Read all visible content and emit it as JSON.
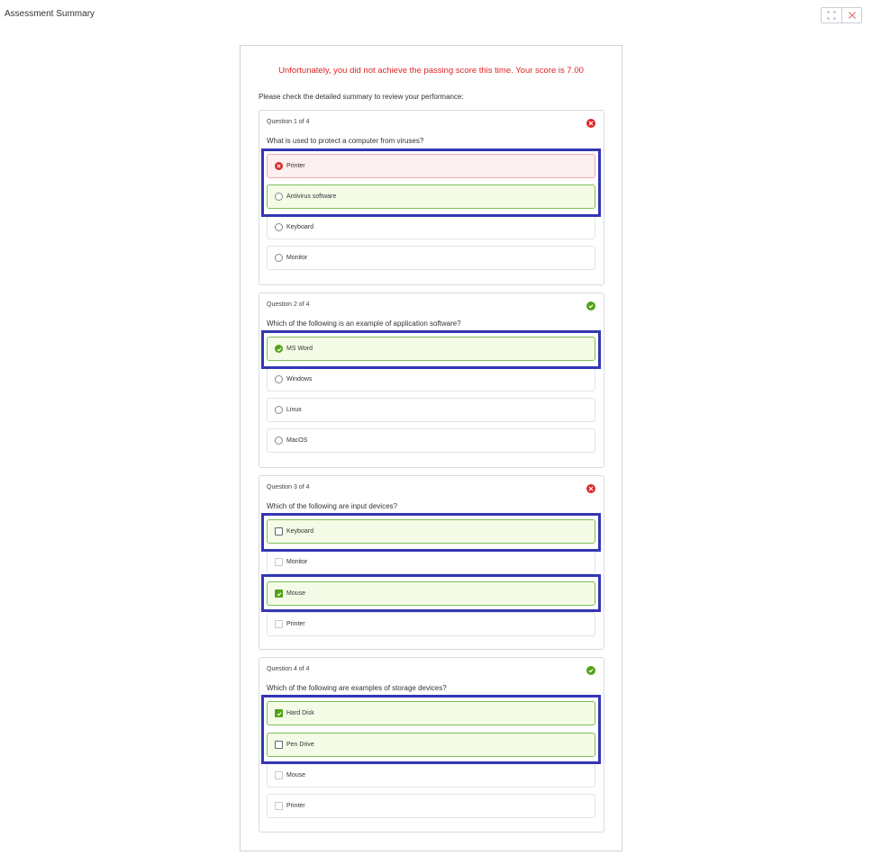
{
  "header": {
    "title": "Assessment Summary"
  },
  "window_controls": {
    "expand_icon": "expand-icon",
    "close_icon": "close-icon"
  },
  "summary": {
    "score_message": "Unfortunately, you did not achieve the passing score this time. Your score is 7.00",
    "hint": "Please check the detailed summary to review your performance:"
  },
  "colors": {
    "error": "#e02424",
    "success": "#52a317",
    "highlight": "#3436b4"
  },
  "questions": [
    {
      "count": "Question 1 of 4",
      "text": "What is used to protect a computer from viruses?",
      "result": "incorrect",
      "input_type": "radio",
      "options": [
        {
          "label": "Printer",
          "state": "selected-wrong"
        },
        {
          "label": "Antivirus software",
          "state": "correct-answer"
        },
        {
          "label": "Keyboard",
          "state": "unselected"
        },
        {
          "label": "Monitor",
          "state": "unselected"
        }
      ]
    },
    {
      "count": "Question 2 of 4",
      "text": "Which of the following is an example of application software?",
      "result": "correct",
      "input_type": "radio",
      "options": [
        {
          "label": "MS Word",
          "state": "selected-correct"
        },
        {
          "label": "Windows",
          "state": "unselected"
        },
        {
          "label": "Linux",
          "state": "unselected"
        },
        {
          "label": "MacOS",
          "state": "unselected"
        }
      ]
    },
    {
      "count": "Question 3 of 4",
      "text": "Which of the following are input devices?",
      "result": "incorrect",
      "input_type": "checkbox",
      "options": [
        {
          "label": "Keyboard",
          "state": "correct-unchecked"
        },
        {
          "label": "Monitor",
          "state": "unselected"
        },
        {
          "label": "Mouse",
          "state": "checked-correct"
        },
        {
          "label": "Printer",
          "state": "unselected"
        }
      ]
    },
    {
      "count": "Question 4 of 4",
      "text": "Which of the following are examples of storage devices?",
      "result": "correct",
      "input_type": "checkbox",
      "options": [
        {
          "label": "Hard Disk",
          "state": "checked-correct"
        },
        {
          "label": "Pen Drive",
          "state": "correct-unchecked"
        },
        {
          "label": "Mouse",
          "state": "unselected"
        },
        {
          "label": "Printer",
          "state": "unselected"
        }
      ]
    }
  ]
}
